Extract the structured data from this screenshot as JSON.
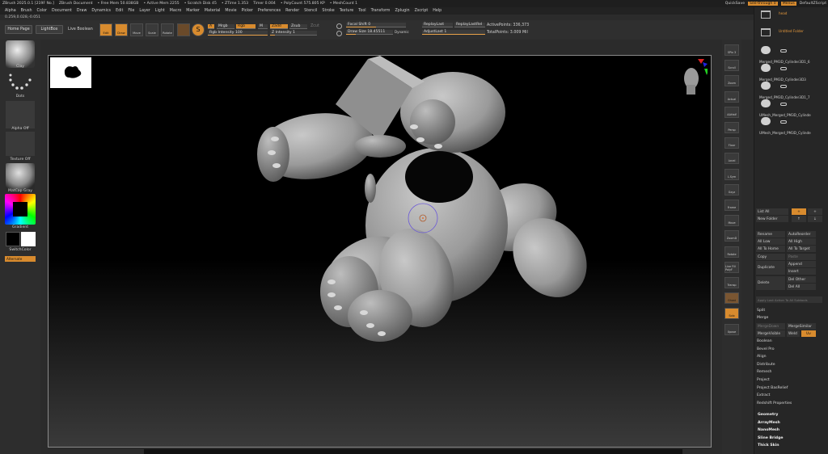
{
  "titlebar": {
    "app": "ZBrush 2025.0.1 [219F No.]",
    "doc": "ZBrush Document",
    "free_mem": "• Free Mem 50.838GB",
    "active_mem": "• Active Mem 2255",
    "scratch": "• Scratch Disk 45",
    "ztime": "• ZTime 1.353",
    "timer": "Timer 0.004",
    "polycount": "• PolyCount 575.805 KP",
    "meshcount": "• MeshCount 1",
    "quicksave": "QuickSave",
    "see_through": "See-through 0",
    "menus": "Menus",
    "script": "DefaultZScript"
  },
  "menubar": [
    "Alpha",
    "Brush",
    "Color",
    "Document",
    "Draw",
    "Dynamics",
    "Edit",
    "File",
    "Layer",
    "Light",
    "Macro",
    "Marker",
    "Material",
    "Movie",
    "Picker",
    "Preferences",
    "Render",
    "Stencil",
    "Stroke",
    "Texture",
    "Tool",
    "Transform",
    "Zplugin",
    "Zscript",
    "Help"
  ],
  "coords": "0.259,0.028,-0.051",
  "toolbar": {
    "home_page": "Home Page",
    "lightbox": "LightBox",
    "live_boolean": "Live Boolean",
    "edit": "Edit",
    "draw": "Draw",
    "move": "Move",
    "scale": "Scale",
    "rotate": "Rotate",
    "a_label": "A",
    "mrgb": "Mrgb",
    "rgb": "Rgb",
    "m": "M",
    "rgb_intensity": "Rgb Intensity 100",
    "zadd": "Zadd",
    "zsub": "Zsub",
    "zcut": "Zcut",
    "z_intensity": "Z Intensity 1",
    "focal_shift": "Focal Shift 0",
    "draw_size": "Draw Size 18.45511",
    "dynamic": "Dynamic",
    "replay_last": "ReplayLast",
    "replay_last_rel": "ReplayLastRel",
    "adjust_last": "AdjustLast 1",
    "active_points": "ActivePoints: 336,373",
    "total_points": "TotalPoints: 3.009 Mil"
  },
  "leftshelf": {
    "brush": "Clay",
    "stroke": "Dots",
    "alpha": "Alpha Off",
    "texture": "Texture Off",
    "material": "MatCap Gray",
    "gradient": "Gradient",
    "switch_color": "SwitchColor",
    "alternate": "Alternate"
  },
  "rightshelf": [
    "SPix 3",
    "Scroll",
    "Zoom",
    "Actual",
    "AAHalf",
    "Persp",
    "Floor",
    "Local",
    "L.Sym",
    "Gxyz",
    "Frame",
    "Move",
    "ZoomD",
    "Rotate",
    "Line Fill PolyF",
    "Transp",
    "Ghost",
    "Solo",
    "Xpose"
  ],
  "subtool": {
    "items": [
      {
        "name": "head",
        "highlight": true
      },
      {
        "name": "Untitled Folder",
        "highlight": true
      },
      {
        "name": "Merged_PM3D_Cylinder3D1_6",
        "highlight": false
      },
      {
        "name": "Merged_PM3D_Cylinder3D3",
        "highlight": false
      },
      {
        "name": "Merged_PM3D_Cylinder3D1_7",
        "highlight": false
      },
      {
        "name": "UMesh_Merged_PM3D_Cylinde",
        "highlight": false
      },
      {
        "name": "UMesh_Merged_PM3D_Cylinde",
        "highlight": false
      }
    ],
    "list_all": "List All",
    "new_folder": "New Folder",
    "rename": "Rename",
    "auto_reorder": "AutoReorder",
    "all_low": "All Low",
    "all_high": "All High",
    "all_to_home": "All To Home",
    "all_to_target": "All To Target",
    "copy": "Copy",
    "paste": "Paste",
    "duplicate": "Duplicate",
    "append": "Append",
    "insert": "Insert",
    "delete": "Delete",
    "del_other": "Del Other",
    "del_all": "Del All",
    "apply_last": "Apply Last Action To All Subtools",
    "split": "Split",
    "merge": "Merge",
    "merge_down": "MergeDown",
    "merge_similar": "MergeSimilar",
    "merge_visible": "MergeVisible",
    "weld": "Weld",
    "uv": "Uv",
    "sections": [
      "Boolean",
      "Bevel Pro",
      "Align",
      "Distribute",
      "Remesh",
      "Project",
      "Project BasRelief",
      "Extract",
      "Redshift Properties"
    ],
    "palettes": [
      "Geometry",
      "ArrayMesh",
      "NanoMesh",
      "Sline Bridge",
      "Thick Skin"
    ]
  },
  "colors": {
    "accent": "#d88b2e",
    "canvas_bg": "#000000",
    "model": "#a9a9a9"
  }
}
